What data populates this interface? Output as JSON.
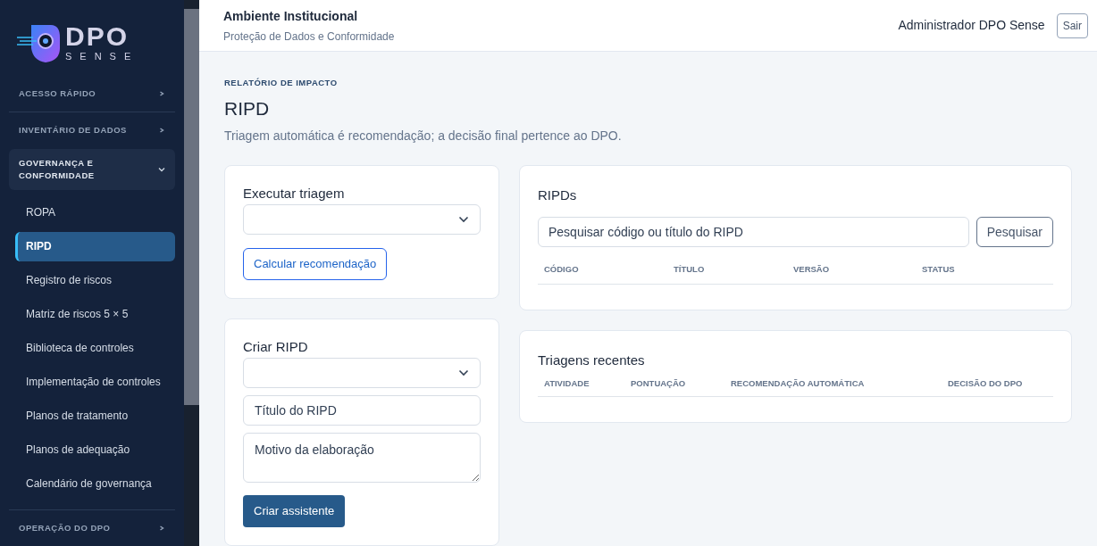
{
  "logo": {
    "title": "DPO",
    "subtitle": "SENSE"
  },
  "sidebar": {
    "groups": [
      {
        "label": "ACESSO RÁPIDO",
        "expanded": false
      },
      {
        "label": "INVENTÁRIO DE DADOS",
        "expanded": false
      },
      {
        "label": "GOVERNANÇA E CONFORMIDADE",
        "expanded": true,
        "items": [
          {
            "label": "ROPA",
            "selected": false
          },
          {
            "label": "RIPD",
            "selected": true
          },
          {
            "label": "Registro de riscos",
            "selected": false
          },
          {
            "label": "Matriz de riscos 5 × 5",
            "selected": false
          },
          {
            "label": "Biblioteca de controles",
            "selected": false
          },
          {
            "label": "Implementação de controles",
            "selected": false
          },
          {
            "label": "Planos de tratamento",
            "selected": false
          },
          {
            "label": "Planos de adequação",
            "selected": false
          },
          {
            "label": "Calendário de governança",
            "selected": false
          }
        ]
      },
      {
        "label": "OPERAÇÃO DO DPO",
        "expanded": false
      }
    ]
  },
  "header": {
    "title": "Ambiente Institucional",
    "subtitle": "Proteção de Dados e Conformidade",
    "user": "Administrador DPO Sense",
    "logout": "Sair"
  },
  "page": {
    "eyebrow": "RELATÓRIO DE IMPACTO",
    "title": "RIPD",
    "description": "Triagem automática é recomendação; a decisão final pertence ao DPO."
  },
  "triage_card": {
    "title": "Executar triagem",
    "button": "Calcular recomendação"
  },
  "create_card": {
    "title": "Criar RIPD",
    "title_placeholder": "Título do RIPD",
    "reason_placeholder": "Motivo da elaboração",
    "button": "Criar assistente"
  },
  "ripds_card": {
    "title": "RIPDs",
    "search_placeholder": "Pesquisar código ou título do RIPD",
    "search_button": "Pesquisar",
    "columns": [
      "CÓDIGO",
      "TÍTULO",
      "VERSÃO",
      "STATUS"
    ]
  },
  "recent_card": {
    "title": "Triagens recentes",
    "columns": [
      "ATIVIDADE",
      "PONTUAÇÃO",
      "RECOMENDAÇÃO AUTOMÁTICA",
      "DECISÃO DO DPO"
    ]
  }
}
